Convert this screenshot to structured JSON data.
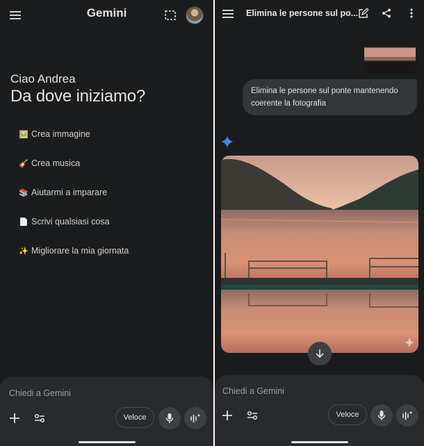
{
  "left": {
    "header": {
      "title": "Gemini",
      "menu_icon": "hamburger-menu-icon",
      "crop_icon": "selection-icon",
      "avatar_icon": "user-avatar"
    },
    "greeting": {
      "name_line": "Ciao Andrea",
      "question": "Da dove iniziamo?"
    },
    "suggestions": [
      {
        "emoji": "🖼️",
        "label": "Crea immagine"
      },
      {
        "emoji": "🎸",
        "label": "Crea musica"
      },
      {
        "emoji": "📚",
        "label": "Aiutarmi a imparare"
      },
      {
        "emoji": "📄",
        "label": "Scrivi qualsiasi cosa"
      },
      {
        "emoji": "✨",
        "label": "Migliorare la mia giornata"
      }
    ],
    "composer": {
      "placeholder": "Chiedi a Gemini",
      "mode_label": "Veloce"
    }
  },
  "right": {
    "header": {
      "title": "Elimina le persone sul po...",
      "menu_icon": "hamburger-menu-icon",
      "edit_icon": "new-chat-icon",
      "share_icon": "share-icon"
    },
    "user_message": "Elimina le persone sul ponte mantenendo coerente la fotografia",
    "composer": {
      "placeholder": "Chiedi a Gemini",
      "mode_label": "Veloce"
    }
  },
  "colors": {
    "background": "#1b1c1d",
    "composer": "#282a2c",
    "bubble": "#333537",
    "accent_blue": "#4285f4"
  }
}
